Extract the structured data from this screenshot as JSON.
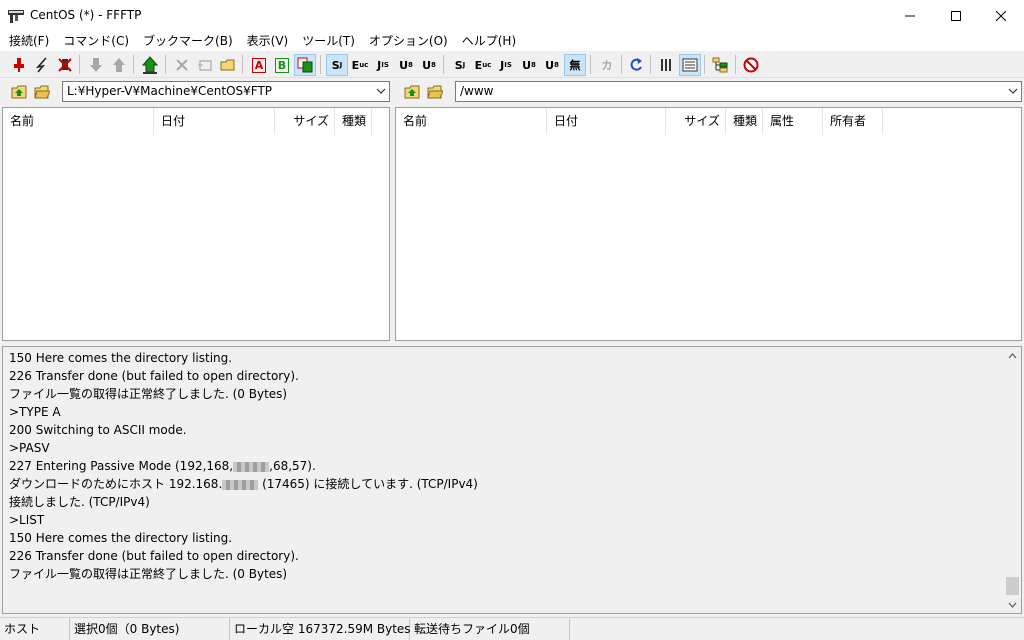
{
  "window": {
    "title": "CentOS (*) - FFFTP"
  },
  "menu": [
    {
      "label": "接続(F)"
    },
    {
      "label": "コマンド(C)"
    },
    {
      "label": "ブックマーク(B)"
    },
    {
      "label": "表示(V)"
    },
    {
      "label": "ツール(T)"
    },
    {
      "label": "オプション(O)"
    },
    {
      "label": "ヘルプ(H)"
    }
  ],
  "toolbar": {
    "kanji": {
      "sjis": "S",
      "euc": "E",
      "jis": "J",
      "utf8n": "U",
      "utf8": "U",
      "none": "無",
      "kana": "カ"
    },
    "transfer": {
      "ascii": "A",
      "binary": "B"
    },
    "colors": {
      "connect_red": "#cc0000",
      "upload_green": "#1a8f1a",
      "refresh_blue": "#1f4fb8",
      "pressed_bg": "#cce4f7"
    }
  },
  "local": {
    "path": "L:¥Hyper-V¥Machine¥CentOS¥FTP",
    "columns": [
      "名前",
      "日付",
      "サイズ",
      "種類"
    ]
  },
  "remote": {
    "path": "/www",
    "columns": [
      "名前",
      "日付",
      "サイズ",
      "種類",
      "属性",
      "所有者"
    ]
  },
  "log": {
    "lines": [
      "150 Here comes the directory listing.",
      "226 Transfer done (but failed to open directory).",
      "ファイル一覧の取得は正常終了しました. (0 Bytes)",
      ">TYPE A",
      "200 Switching to ASCII mode.",
      ">PASV"
    ],
    "pasv_prefix": "227 Entering Passive Mode (192,168,",
    "pasv_suffix": ",68,57).",
    "connect_prefix": "ダウンロードのためにホスト 192.168.",
    "connect_suffix": " (17465) に接続しています. (TCP/IPv4)",
    "lines_after": [
      "接続しました. (TCP/IPv4)",
      ">LIST",
      "150 Here comes the directory listing.",
      "226 Transfer done (but failed to open directory).",
      "ファイル一覧の取得は正常終了しました. (0 Bytes)"
    ]
  },
  "status": {
    "host": "ホスト",
    "selection": "選択0個（0 Bytes)",
    "local_free": "ローカル空 167372.59M Bytes",
    "queue": "転送待ちファイル0個"
  }
}
